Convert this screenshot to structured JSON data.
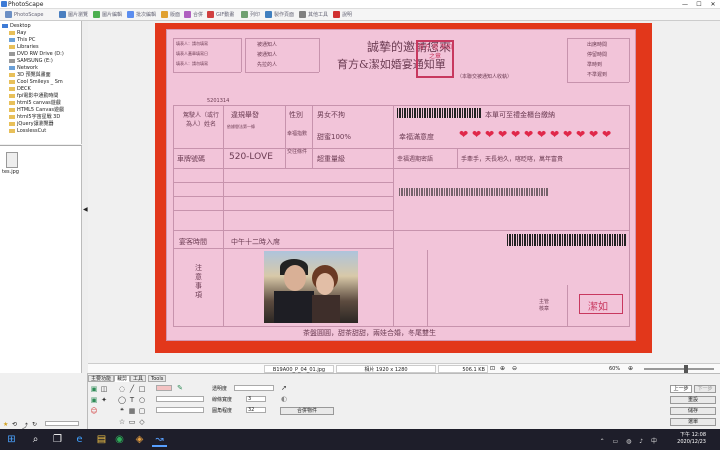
{
  "app": {
    "title": "PhotoScape"
  },
  "menu_tabs": [
    {
      "label": "PhotoScape",
      "color": "#6b8fc4"
    },
    {
      "label": "圖片瀏覽",
      "color": "#4a7fc0"
    },
    {
      "label": "圖片編輯",
      "color": "#4caf50"
    },
    {
      "label": "批次編輯",
      "color": "#5b8def"
    },
    {
      "label": "版面",
      "color": "#e0a030"
    },
    {
      "label": "合併",
      "color": "#b060c0"
    },
    {
      "label": "GIF動畫",
      "color": "#d04040"
    },
    {
      "label": "列印",
      "color": "#70a070"
    },
    {
      "label": "製作頁面",
      "color": "#3f7fbf"
    },
    {
      "label": "其他工具",
      "color": "#808080"
    },
    {
      "label": "說明",
      "color": "#d03030"
    }
  ],
  "tree": [
    {
      "label": "Desktop",
      "depth": 0
    },
    {
      "label": "Ray",
      "depth": 1
    },
    {
      "label": "This PC",
      "depth": 1
    },
    {
      "label": "Libraries",
      "depth": 1
    },
    {
      "label": "DVD RW Drive (D:)",
      "depth": 1
    },
    {
      "label": "SAMSUNG (E:)",
      "depth": 1
    },
    {
      "label": "Network",
      "depth": 1
    },
    {
      "label": "3D 預覽與畫面",
      "depth": 1
    },
    {
      "label": "Cool Smileys _ Sm",
      "depth": 1
    },
    {
      "label": "DECK",
      "depth": 1
    },
    {
      "label": "fpi電影中通勤時間",
      "depth": 1
    },
    {
      "label": "html5 canvas遊戲",
      "depth": 1
    },
    {
      "label": "HTML5 Canvas遊戲",
      "depth": 1
    },
    {
      "label": "html5宇宙星戰 3D",
      "depth": 1
    },
    {
      "label": "jQuery讓瀏覽器",
      "depth": 1
    },
    {
      "label": "LosslessCut",
      "depth": 1
    }
  ],
  "file": {
    "name": "tes.jpg"
  },
  "card": {
    "title": "誠摯的邀請您來",
    "subtitle": "育方&潔如婚宴通知單",
    "note": "（本聯交被通知人收執）",
    "small_left": [
      "填表人：請勿填寫",
      "填表人蓋章填寫日",
      "填表人：請勿填寫"
    ],
    "small_mid": [
      "被通知人",
      "被通知人",
      "先拉的人"
    ],
    "small_right": [
      "出席時間",
      "停留時間",
      "準時到",
      "不準遲到"
    ],
    "serial": "5201314",
    "row1": {
      "label": "駕駛人（或行為人）姓名",
      "field": "違規舉發",
      "field_note": "依據戀法第一條",
      "gender": "性別",
      "gender_val": "男女不拘",
      "notice": "本單可至禮金櫃台繳納"
    },
    "row2": {
      "happy": "幸福指數",
      "happy_val": "甜蜜100%",
      "level": "幸福滿意度"
    },
    "row3": {
      "plate": "車牌號碼",
      "plate_val": "520-LOVE",
      "vows": "交往條件",
      "vows_val": "超重量級",
      "content": "幸福週期密語",
      "content_val": "手牽手，天長地久，喀眨喀，萬年富貴"
    },
    "time_label": "宴客時間",
    "time_val": "中午十二時入席",
    "notes_label": "注意事項",
    "footer": "茶盤圓圓，甜茶甜甜，兩娃合婚，冬尾雙生",
    "seal": "潔如",
    "officer": "主管核章",
    "stamp": "育方 禮 潔如 之章"
  },
  "status": {
    "filename": "B19A00_P_04_01.jpg",
    "dims": "相片 1920 x 1280",
    "size": "506.1 KB",
    "zoom": "60%"
  },
  "panel": {
    "tabs": [
      "主要功能",
      "裁剪",
      "工具",
      "Tools"
    ],
    "opacity_label": "透明度",
    "line_width_label": "線條寬度",
    "line_width_val": "3",
    "radius_label": "圓角程度",
    "radius_val": "32",
    "merge_button": "合併物件",
    "buttons": [
      "上一步",
      "下一步",
      "重設",
      "儲存",
      "選單"
    ]
  },
  "taskbar": {
    "time": "下午 12:08",
    "date": "2020/12/23"
  }
}
